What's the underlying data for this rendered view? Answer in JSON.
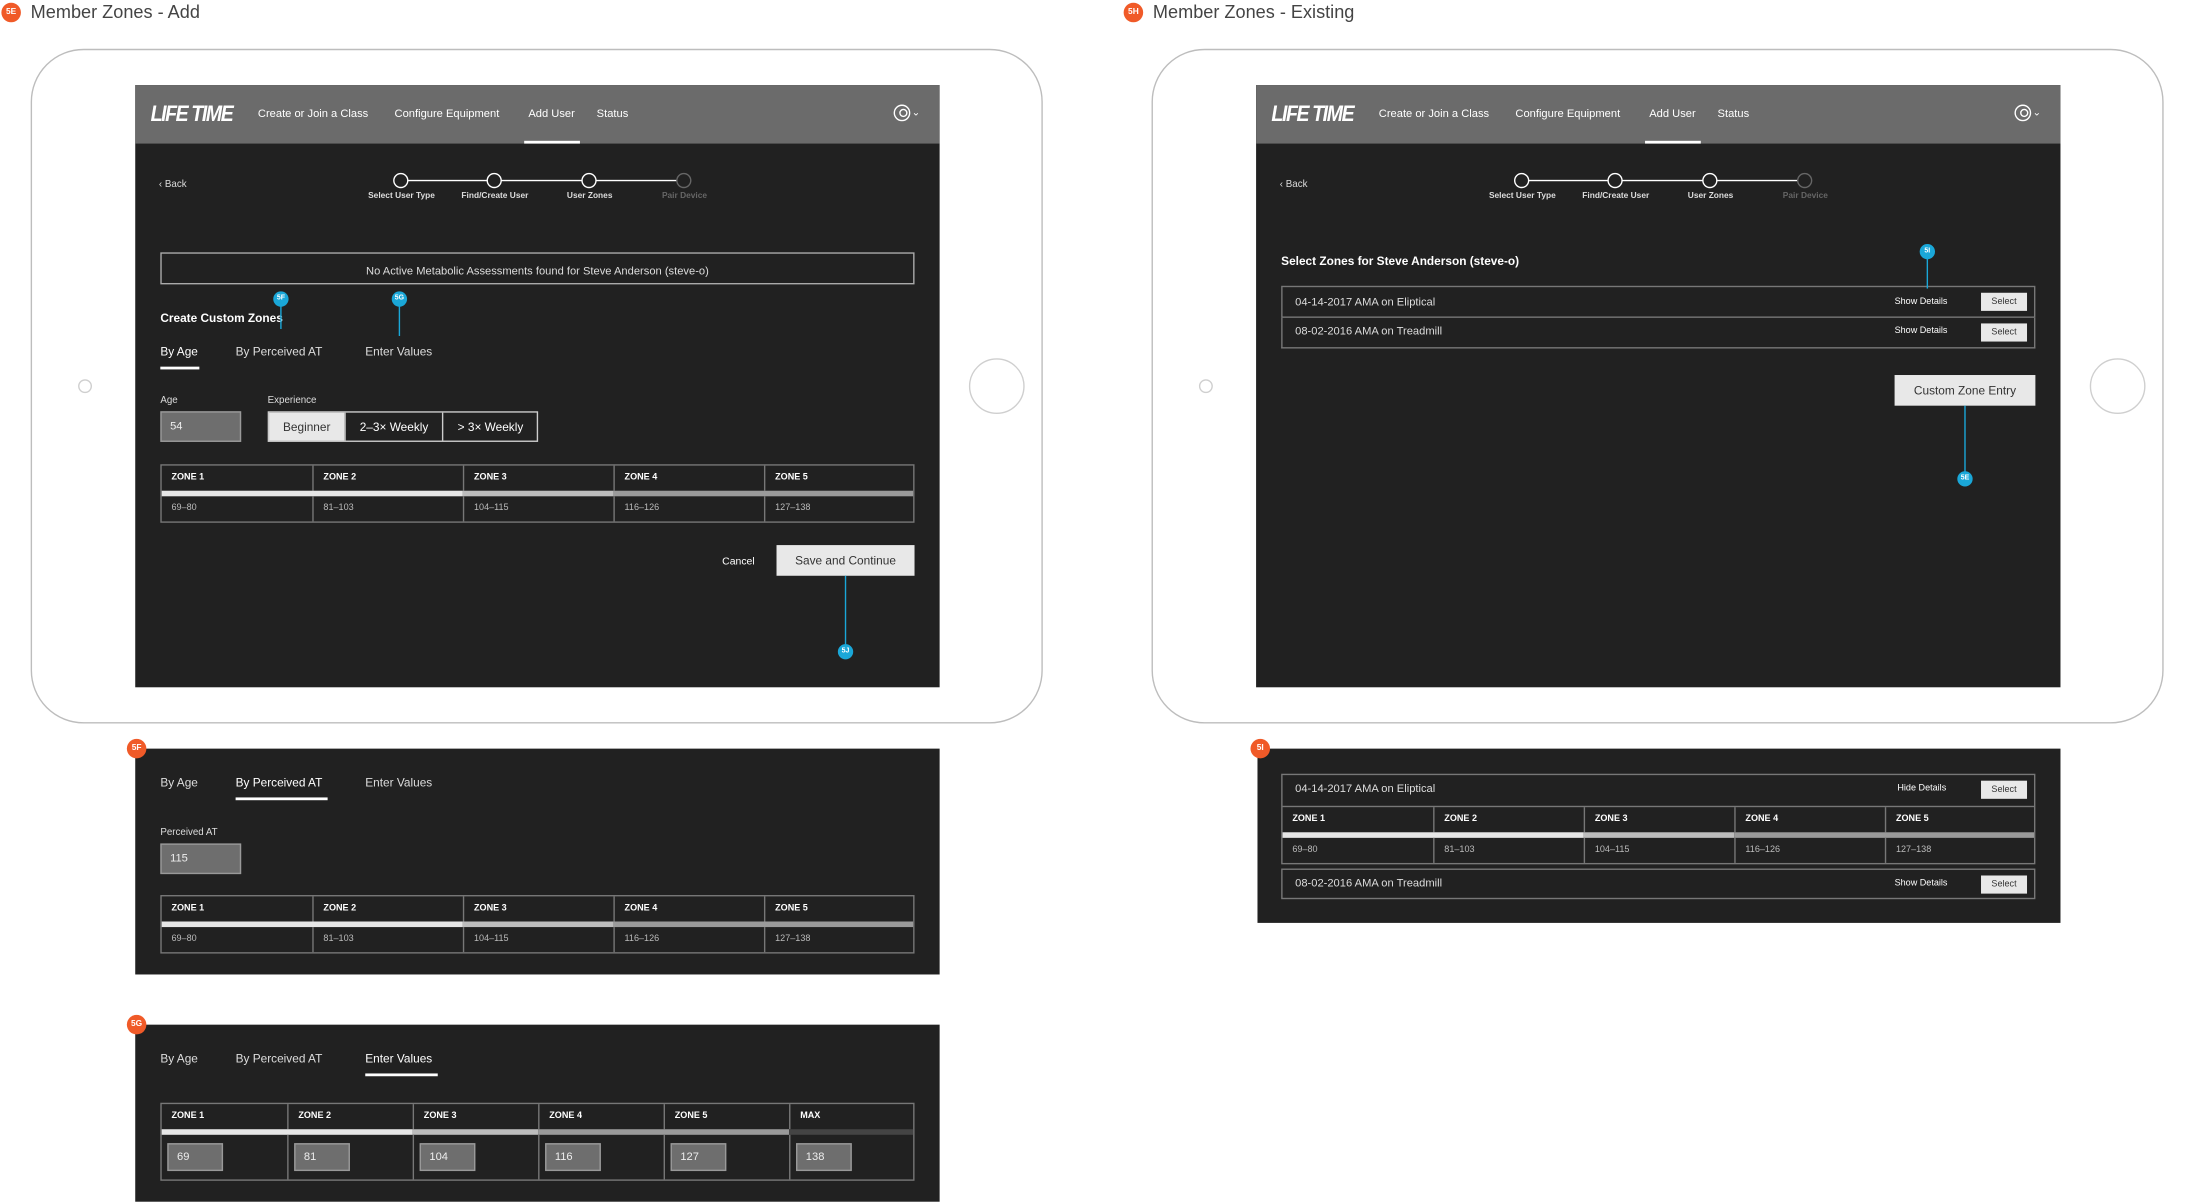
{
  "left_title": "Member Zones - Add",
  "left_tag": "5E",
  "right_title": "Member Zones - Existing",
  "right_tag": "5H",
  "nav": {
    "logo": "LIFE TIME",
    "items": [
      "Create or Join a Class",
      "Configure Equipment",
      "Add User",
      "Status"
    ],
    "active": "Add User"
  },
  "back": "Back",
  "steps": [
    "Select User Type",
    "Find/Create User",
    "User Zones",
    "Pair Device"
  ],
  "add": {
    "notice": "No Active Metabolic Assessments found for Steve Anderson (steve-o)",
    "heading": "Create Custom Zones",
    "tabs": [
      "By Age",
      "By Perceived AT",
      "Enter Values"
    ],
    "age_label": "Age",
    "age_value": "54",
    "experience_label": "Experience",
    "experience_options": [
      "Beginner",
      "2–3× Weekly",
      "> 3× Weekly"
    ],
    "experience_selected": "Beginner",
    "zones": [
      "ZONE 1",
      "ZONE 2",
      "ZONE 3",
      "ZONE 4",
      "ZONE 5"
    ],
    "zone_values": [
      "69–80",
      "81–103",
      "104–115",
      "116–126",
      "127–138"
    ],
    "cancel": "Cancel",
    "save": "Save and Continue",
    "pins": {
      "tab_perceived": "5F",
      "tab_enter": "5G",
      "save": "5J"
    }
  },
  "panel_5f": {
    "tag": "5F",
    "tabs": [
      "By Age",
      "By Perceived AT",
      "Enter Values"
    ],
    "field_label": "Perceived AT",
    "field_value": "115",
    "zones": [
      "ZONE 1",
      "ZONE 2",
      "ZONE 3",
      "ZONE 4",
      "ZONE 5"
    ],
    "zone_values": [
      "69–80",
      "81–103",
      "104–115",
      "116–126",
      "127–138"
    ]
  },
  "panel_5g": {
    "tag": "5G",
    "tabs": [
      "By Age",
      "By Perceived AT",
      "Enter Values"
    ],
    "zones": [
      "ZONE 1",
      "ZONE 2",
      "ZONE 3",
      "ZONE 4",
      "ZONE 5",
      "MAX"
    ],
    "inputs": [
      "69",
      "81",
      "104",
      "116",
      "127",
      "138"
    ]
  },
  "existing": {
    "heading": "Select Zones for Steve Anderson (steve-o)",
    "rows": [
      {
        "name": "04-14-2017 AMA on Eliptical",
        "details": "Show Details",
        "select": "Select"
      },
      {
        "name": "08-02-2016 AMA on Treadmill",
        "details": "Show Details",
        "select": "Select"
      }
    ],
    "custom_button": "Custom Zone Entry",
    "pins": {
      "details": "5I",
      "custom": "5E"
    }
  },
  "panel_5i": {
    "tag": "5I",
    "row1": {
      "name": "04-14-2017 AMA on Eliptical",
      "details": "Hide Details",
      "select": "Select"
    },
    "zones": [
      "ZONE 1",
      "ZONE 2",
      "ZONE 3",
      "ZONE 4",
      "ZONE 5"
    ],
    "zone_values": [
      "69–80",
      "81–103",
      "104–115",
      "116–126",
      "127–138"
    ],
    "row2": {
      "name": "08-02-2016 AMA on Treadmill",
      "details": "Show Details",
      "select": "Select"
    }
  },
  "colors": {
    "screen": "#212121",
    "nav": "#6b6b6b",
    "tag": "#f05a28",
    "pin": "#1aa7d8"
  }
}
